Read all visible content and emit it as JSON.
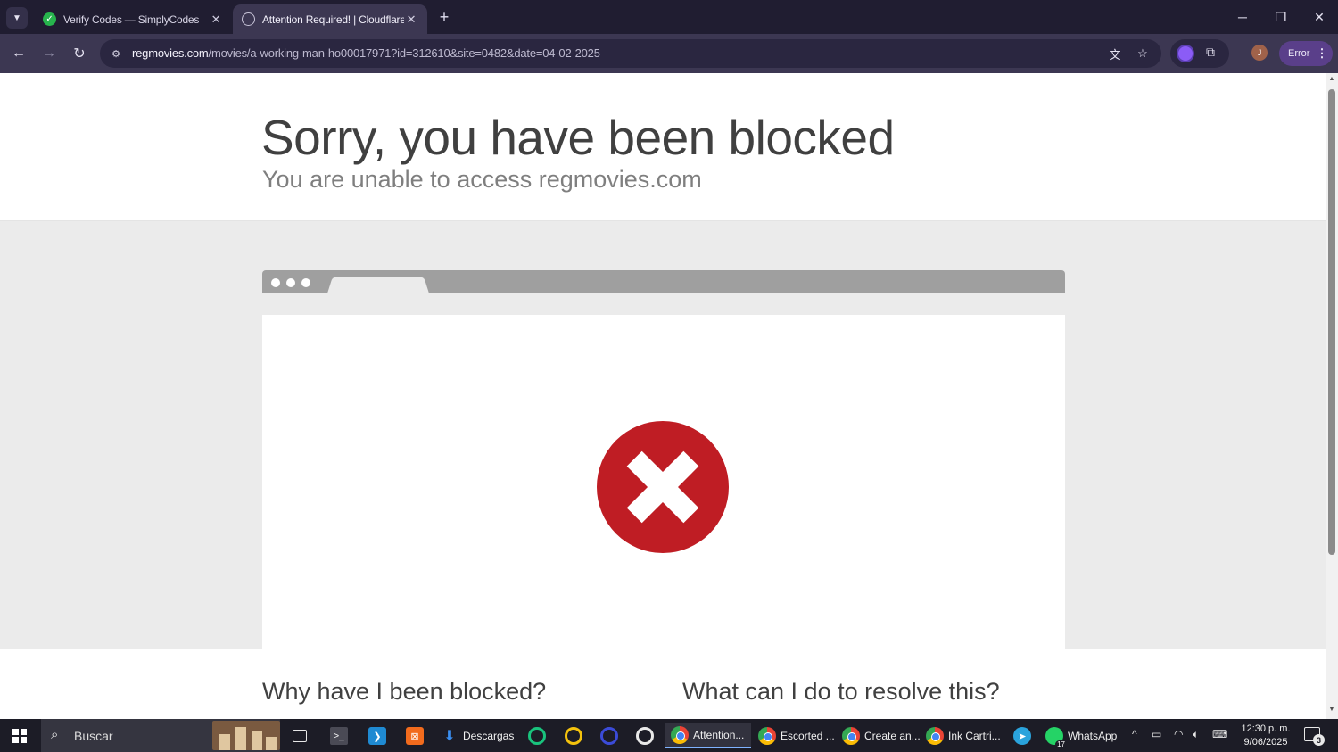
{
  "browser": {
    "tabs": [
      {
        "title": "Verify Codes — SimplyCodes",
        "icon": "simplycodes-check-icon",
        "active": false
      },
      {
        "title": "Attention Required! | Cloudflare",
        "icon": "globe-icon",
        "active": true
      }
    ],
    "new_tab_symbol": "+",
    "address": {
      "host": "regmovies.com",
      "path": "/movies/a-working-man-ho00017971?id=312610&site=0482&date=04-02-2025"
    },
    "profile_initial": "J",
    "error_label": "Error"
  },
  "page": {
    "title": "Sorry, you have been blocked",
    "subtitle": "You are unable to access regmovies.com",
    "why_heading": "Why have I been blocked?",
    "resolve_heading": "What can I do to resolve this?"
  },
  "colors": {
    "blocked_red": "#bf1d24",
    "chrome_frame": "#3c3752",
    "tab_strip": "#201d31"
  },
  "taskbar": {
    "search_placeholder": "Buscar",
    "items": [
      {
        "label": "Descargas"
      },
      {
        "label": "Attention..."
      },
      {
        "label": "Escorted ..."
      },
      {
        "label": "Create an..."
      },
      {
        "label": "Ink Cartri..."
      },
      {
        "label": "WhatsApp"
      }
    ],
    "clock_time": "12:30 p. m.",
    "clock_date": "9/06/2025",
    "notification_count": "3",
    "whatsapp_badge": "17"
  }
}
